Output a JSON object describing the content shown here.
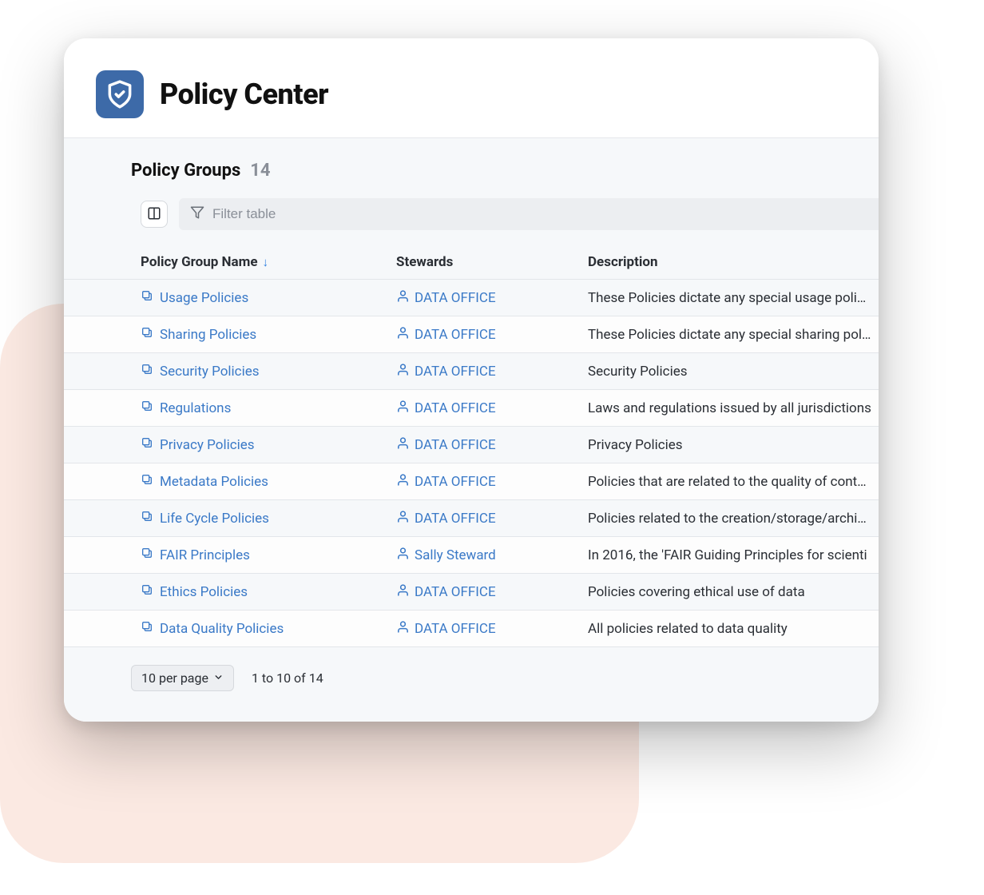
{
  "header": {
    "title": "Policy Center"
  },
  "section": {
    "title": "Policy Groups",
    "count": "14"
  },
  "filter": {
    "placeholder": "Filter table"
  },
  "columns": {
    "name": "Policy Group Name",
    "stewards": "Stewards",
    "description": "Description"
  },
  "rows": [
    {
      "name": "Usage Policies",
      "steward": "DATA OFFICE",
      "description": "These Policies dictate any special usage policie"
    },
    {
      "name": "Sharing Policies",
      "steward": "DATA OFFICE",
      "description": "These Policies dictate any special sharing polic"
    },
    {
      "name": "Security Policies",
      "steward": "DATA OFFICE",
      "description": "Security Policies"
    },
    {
      "name": "Regulations",
      "steward": "DATA OFFICE",
      "description": "Laws and regulations issued by all jurisdictions"
    },
    {
      "name": "Privacy Policies",
      "steward": "DATA OFFICE",
      "description": "Privacy Policies"
    },
    {
      "name": "Metadata Policies",
      "steward": "DATA OFFICE",
      "description": "Policies that are related to the quality of context"
    },
    {
      "name": "Life Cycle Policies",
      "steward": "DATA OFFICE",
      "description": "Policies related to the creation/storage/archive/"
    },
    {
      "name": "FAIR Principles",
      "steward": "Sally Steward",
      "description": "In 2016, the 'FAIR Guiding Principles for scienti"
    },
    {
      "name": "Ethics Policies",
      "steward": "DATA OFFICE",
      "description": "Policies covering ethical use of data"
    },
    {
      "name": "Data Quality Policies",
      "steward": "DATA OFFICE",
      "description": "All policies related to data quality"
    }
  ],
  "pagination": {
    "per_page_label": "10 per page",
    "range": "1 to 10 of 14"
  }
}
